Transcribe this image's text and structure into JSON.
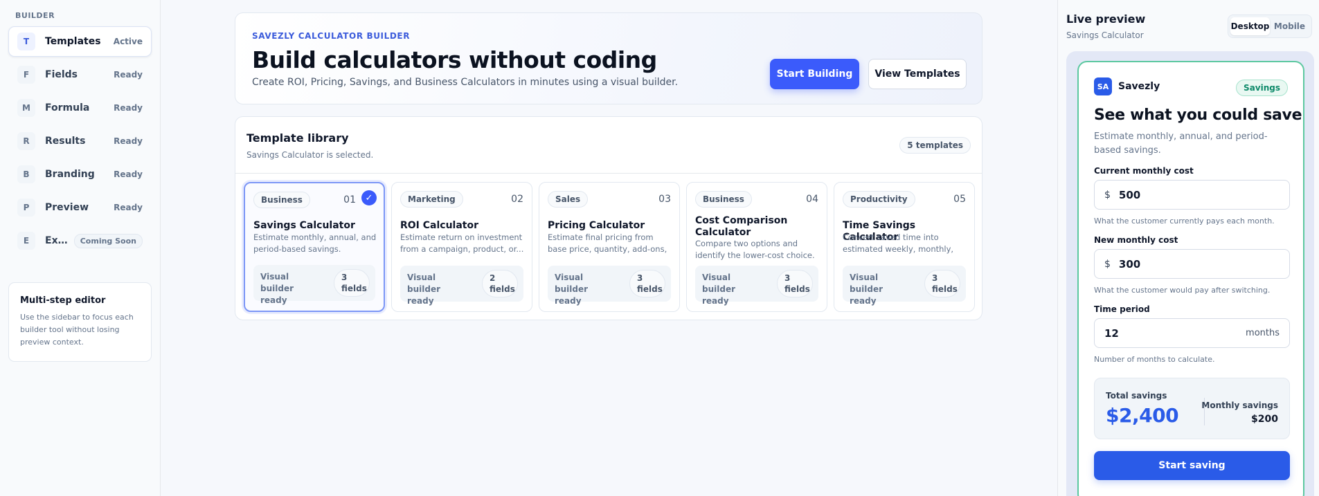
{
  "sidebar": {
    "title": "BUILDER",
    "items": [
      {
        "letter": "T",
        "label": "Templates",
        "status": "Active"
      },
      {
        "letter": "F",
        "label": "Fields",
        "status": "Ready"
      },
      {
        "letter": "M",
        "label": "Formula",
        "status": "Ready"
      },
      {
        "letter": "R",
        "label": "Results",
        "status": "Ready"
      },
      {
        "letter": "B",
        "label": "Branding",
        "status": "Ready"
      },
      {
        "letter": "P",
        "label": "Preview",
        "status": "Ready"
      },
      {
        "letter": "E",
        "label": "Exp...",
        "status": "Coming Soon"
      }
    ],
    "note": {
      "title": "Multi-step editor",
      "body": "Use the sidebar to focus each builder tool without losing preview context."
    }
  },
  "hero": {
    "eyebrow": "SAVEZLY CALCULATOR BUILDER",
    "title": "Build calculators without coding",
    "subtitle": "Create ROI, Pricing, Savings, and Business Calculators in minutes using a visual builder.",
    "primary_label": "Start Building",
    "secondary_label": "View Templates"
  },
  "library": {
    "title": "Template library",
    "subtitle": "Savings Calculator is selected.",
    "count": "5 templates",
    "cards": [
      {
        "tag": "Business",
        "num": "01",
        "title": "Savings Calculator",
        "desc": "Estimate monthly, annual, and period-based savings.",
        "foot": "Visual builder ready",
        "fields": "3 fields",
        "check": "✓"
      },
      {
        "tag": "Marketing",
        "num": "02",
        "title": "ROI Calculator",
        "desc": "Estimate return on investment from a campaign, product, or...",
        "foot": "Visual builder ready",
        "fields": "2 fields"
      },
      {
        "tag": "Sales",
        "num": "03",
        "title": "Pricing Calculator",
        "desc": "Estimate final pricing from base price, quantity, add-ons, and...",
        "foot": "Visual builder ready",
        "fields": "3 fields"
      },
      {
        "tag": "Business",
        "num": "04",
        "title": "Cost Comparison Calculator",
        "desc": "Compare two options and identify the lower-cost choice.",
        "foot": "Visual builder ready",
        "fields": "3 fields"
      },
      {
        "tag": "Productivity",
        "num": "05",
        "title": "Time Savings Calculator",
        "desc": "Convert saved time into estimated weekly, monthly, and...",
        "foot": "Visual builder ready",
        "fields": "3 fields"
      }
    ]
  },
  "preview": {
    "title": "Live preview",
    "subtitle": "Savings Calculator",
    "toggle": [
      "Desktop",
      "Mobile"
    ],
    "brand_logo": "SA",
    "brand_name": "Savezly",
    "brand_badge": "Savings",
    "heading": "See what you could save",
    "description": "Estimate monthly, annual, and period-based savings.",
    "fields": [
      {
        "label": "Current monthly cost",
        "prefix": "$",
        "value": "500",
        "help": "What the customer currently pays each month."
      },
      {
        "label": "New monthly cost",
        "prefix": "$",
        "value": "300",
        "help": "What the customer would pay after switching."
      },
      {
        "label": "Time period",
        "value": "12",
        "suffix": "months",
        "help": "Number of months to calculate."
      }
    ],
    "total_label": "Total savings",
    "total_value": "$2,400",
    "monthly_label": "Monthly savings",
    "monthly_value": "$200",
    "cta": "Start saving"
  },
  "colors": {
    "accent": "#3b5bfb",
    "preview_accent": "#2a5be8",
    "preview_border": "#5cc8a0"
  }
}
